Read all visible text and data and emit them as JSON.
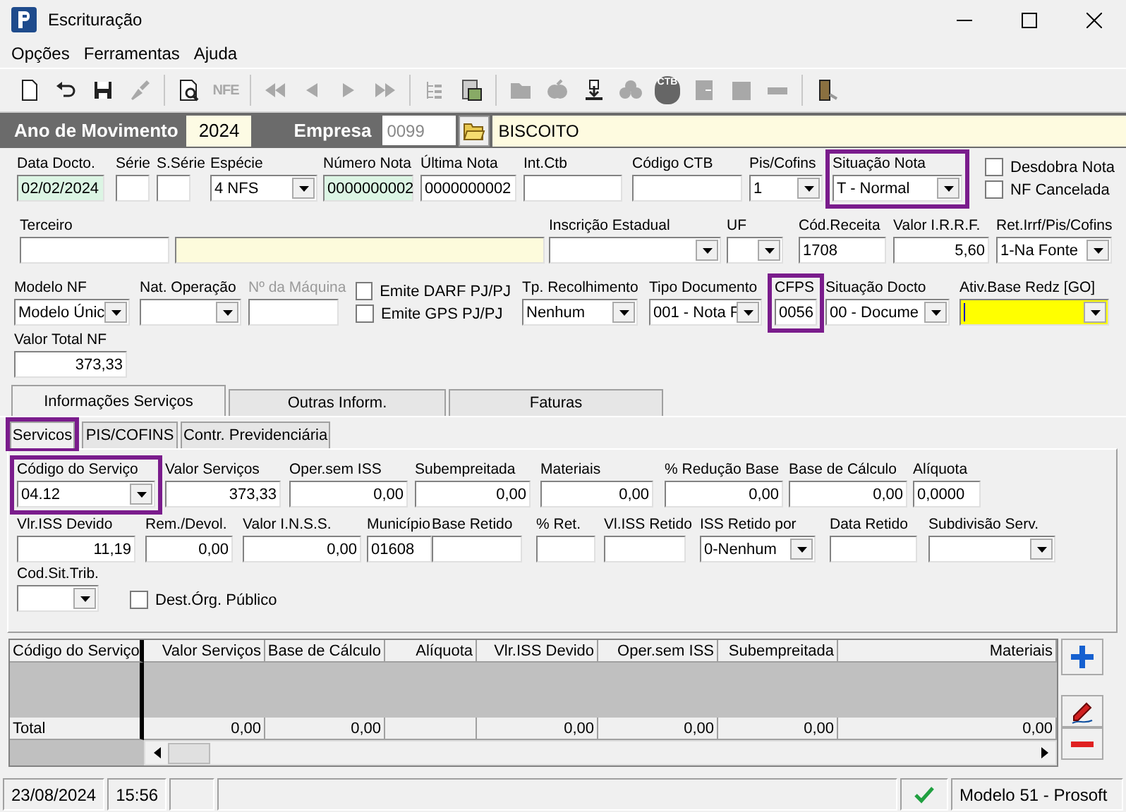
{
  "window": {
    "title": "Escrituração"
  },
  "menu": [
    "Opções",
    "Ferramentas",
    "Ajuda"
  ],
  "toolbar": [
    [
      {
        "kind": "new",
        "disabled": false
      },
      {
        "kind": "undo",
        "disabled": false
      },
      {
        "kind": "save",
        "disabled": false
      },
      {
        "kind": "brush",
        "disabled": true
      }
    ],
    [
      {
        "kind": "preview",
        "disabled": false
      },
      {
        "kind": "text",
        "label": "NFE",
        "disabled": true
      }
    ],
    [
      {
        "kind": "first",
        "disabled": true
      },
      {
        "kind": "prev",
        "disabled": true
      },
      {
        "kind": "next",
        "disabled": true
      },
      {
        "kind": "last",
        "disabled": true
      }
    ],
    [
      {
        "kind": "tree",
        "disabled": true
      },
      {
        "kind": "report",
        "disabled": false
      }
    ],
    [
      {
        "kind": "folder",
        "disabled": true
      },
      {
        "kind": "apple",
        "disabled": true
      },
      {
        "kind": "import",
        "disabled": false
      },
      {
        "kind": "cloud",
        "disabled": true
      },
      {
        "kind": "bag",
        "label": "CTB",
        "disabled": false
      },
      {
        "kind": "panel",
        "disabled": true
      },
      {
        "kind": "square",
        "disabled": true
      },
      {
        "kind": "minus",
        "disabled": true
      }
    ],
    [
      {
        "kind": "exit",
        "disabled": false
      }
    ]
  ],
  "header": {
    "year_label": "Ano de Movimento",
    "year": "2024",
    "company_label": "Empresa",
    "company_code": "0099",
    "company_name": "BISCOITO"
  },
  "form": {
    "rows": [
      {
        "fields": [
          {
            "kind": "text",
            "label": "Data Docto.",
            "value": "02/02/2024",
            "color": "#dcf5e4"
          },
          {
            "kind": "text",
            "label": "Série"
          },
          {
            "kind": "text",
            "label": "S.Série"
          },
          {
            "kind": "combo",
            "label": "Espécie",
            "value": "4 NFS"
          },
          {
            "kind": "text",
            "label": "Número Nota",
            "value": "0000000002",
            "color": "#dcf5e4"
          },
          {
            "kind": "text",
            "label": "Última Nota",
            "value": "0000000002"
          },
          {
            "kind": "text",
            "label": "Int.Ctb"
          },
          {
            "kind": "text",
            "label": "Código CTB"
          },
          {
            "kind": "combo",
            "label": "Pis/Cofins",
            "value": "1"
          },
          {
            "kind": "combo",
            "label": "Situação Nota",
            "value": "T - Normal",
            "highlighted": true
          },
          {
            "kind": "checks",
            "items": [
              {
                "label": "Desdobra Nota",
                "checked": false
              },
              {
                "label": "NF Cancelada",
                "checked": false
              }
            ]
          }
        ]
      },
      {
        "fields": [
          {
            "kind": "text",
            "label": "Terceiro"
          },
          {
            "kind": "text",
            "color": "#fdfbdc"
          },
          {
            "kind": "combo",
            "label": "Inscrição Estadual"
          },
          {
            "kind": "combo",
            "label": "UF"
          },
          {
            "kind": "text",
            "label": "Cód.Receita",
            "value": "1708"
          },
          {
            "kind": "amount",
            "label": "Valor I.R.R.F.",
            "value": "5,60"
          },
          {
            "kind": "combo",
            "label": "Ret.Irrf/Pis/Cofins",
            "value": "1-Na Fonte"
          }
        ]
      },
      {
        "fields": [
          {
            "kind": "combo",
            "label": "Modelo NF",
            "value": "Modelo Únic"
          },
          {
            "kind": "combo",
            "label": "Nat. Operação"
          },
          {
            "kind": "text",
            "label": "Nº da Máquina",
            "disabled": true
          },
          {
            "kind": "checks",
            "items": [
              {
                "label": "Emite DARF PJ/PJ",
                "checked": false
              },
              {
                "label": "Emite GPS PJ/PJ",
                "checked": false
              }
            ]
          },
          {
            "kind": "combo",
            "label": "Tp. Recolhimento",
            "value": "Nenhum"
          },
          {
            "kind": "combo",
            "label": "Tipo Documento",
            "value": "001 - Nota F"
          },
          {
            "kind": "text",
            "label": "CFPS",
            "value": "0056",
            "highlighted": true
          },
          {
            "kind": "combo",
            "label": "Situação Docto",
            "value": "00 - Docume"
          },
          {
            "kind": "combo",
            "label": "Ativ.Base Redz [GO]",
            "color": "#ffff00",
            "focused": true
          }
        ]
      },
      {
        "fields": [
          {
            "kind": "amount",
            "label": "Valor Total NF",
            "value": "373,33"
          }
        ]
      }
    ]
  },
  "tabs": [
    {
      "label": "Informações Serviços",
      "selected": true
    },
    {
      "label": "Outras Inform.",
      "selected": false
    },
    {
      "label": "Faturas",
      "selected": false
    }
  ],
  "subtabs": [
    {
      "label": "Servicos",
      "selected": true,
      "highlighted": true
    },
    {
      "label": "PIS/COFINS",
      "selected": false
    },
    {
      "label": "Contr. Previdenciária",
      "selected": false
    }
  ],
  "service_form": {
    "rows": [
      {
        "fields": [
          {
            "kind": "combo",
            "label": "Código do Serviço",
            "value": "04.12",
            "highlighted": true
          },
          {
            "kind": "amount",
            "label": "Valor Serviços",
            "value": "373,33"
          },
          {
            "kind": "amount",
            "label": "Oper.sem ISS",
            "value": "0,00"
          },
          {
            "kind": "amount",
            "label": "Subempreitada",
            "value": "0,00"
          },
          {
            "kind": "amount",
            "label": "Materiais",
            "value": "0,00"
          },
          {
            "kind": "amount",
            "label": "% Redução Base",
            "value": "0,00"
          },
          {
            "kind": "amount",
            "label": "Base de Cálculo",
            "value": "0,00"
          },
          {
            "kind": "text",
            "label": "Alíquota",
            "value": "0,0000"
          }
        ]
      },
      {
        "fields": [
          {
            "kind": "amount",
            "label": "Vlr.ISS Devido",
            "value": "11,19"
          },
          {
            "kind": "amount",
            "label": "Rem./Devol.",
            "value": "0,00"
          },
          {
            "kind": "amount",
            "label": "Valor I.N.S.S.",
            "value": "0,00"
          },
          {
            "kind": "text",
            "label": "Município",
            "value": "01608"
          },
          {
            "kind": "text",
            "label": "Base Retido"
          },
          {
            "kind": "text",
            "label": "% Ret."
          },
          {
            "kind": "text",
            "label": "Vl.ISS Retido"
          },
          {
            "kind": "combo",
            "label": "ISS Retido por",
            "value": "0-Nenhum"
          },
          {
            "kind": "text",
            "label": "Data Retido"
          },
          {
            "kind": "combo",
            "label": "Subdivisão Serv."
          }
        ]
      },
      {
        "fields": [
          {
            "kind": "combo",
            "label": "Cod.Sit.Trib."
          },
          {
            "kind": "checks",
            "items": [
              {
                "label": "Dest.Órg. Público",
                "checked": false
              }
            ]
          }
        ]
      }
    ]
  },
  "grid": {
    "columns": [
      {
        "header": "Código do Serviço",
        "total": "Total"
      },
      {
        "header": "Valor Serviços",
        "total": "0,00"
      },
      {
        "header": "Base de Cálculo",
        "total": "0,00"
      },
      {
        "header": "Alíquota"
      },
      {
        "header": "Vlr.ISS Devido",
        "total": "0,00"
      },
      {
        "header": "Oper.sem ISS",
        "total": "0,00"
      },
      {
        "header": "Subempreitada",
        "total": "0,00"
      },
      {
        "header": "Materiais",
        "total": "0,00"
      }
    ]
  },
  "grid_actions": [
    {
      "kind": "add"
    },
    {
      "kind": "edit"
    },
    {
      "kind": "remove"
    }
  ],
  "status_bar": {
    "date": "23/08/2024",
    "time": "15:56",
    "ok": true,
    "model": "Modelo 51 - Prosoft"
  }
}
